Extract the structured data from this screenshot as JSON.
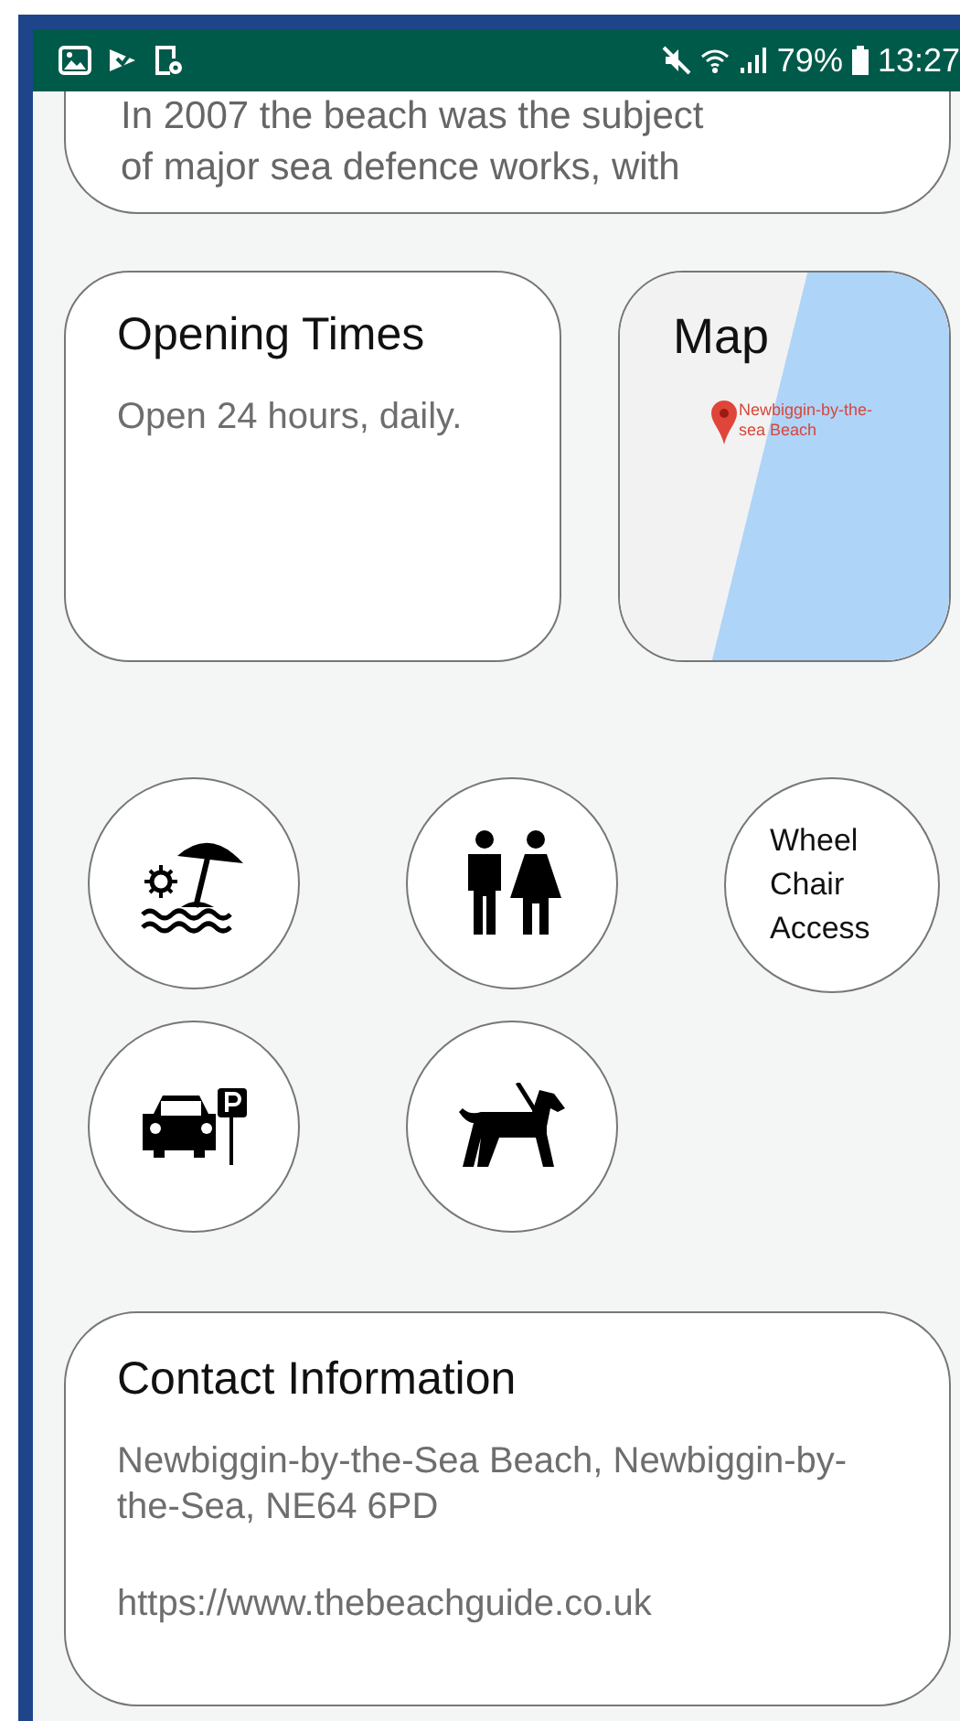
{
  "status_bar": {
    "battery": "79%",
    "time": "13:27"
  },
  "intro_card": {
    "lines": [
      "In 2007 the beach was the subject",
      "of major sea defence works, with"
    ]
  },
  "opening_times": {
    "title": "Opening Times",
    "text": "Open 24 hours, daily."
  },
  "map": {
    "title": "Map",
    "pin_label": "Newbiggin-by-the-sea Beach"
  },
  "amenities": [
    {
      "kind": "icon"
    },
    {
      "kind": "icon"
    },
    {
      "kind": "text",
      "label": "Wheel Chair Access"
    },
    {
      "kind": "icon"
    },
    {
      "kind": "icon"
    }
  ],
  "contact": {
    "title": "Contact Information",
    "address": "Newbiggin-by-the-Sea Beach, Newbiggin-by-the-Sea, NE64 6PD",
    "url": "https://www.thebeachguide.co.uk"
  }
}
